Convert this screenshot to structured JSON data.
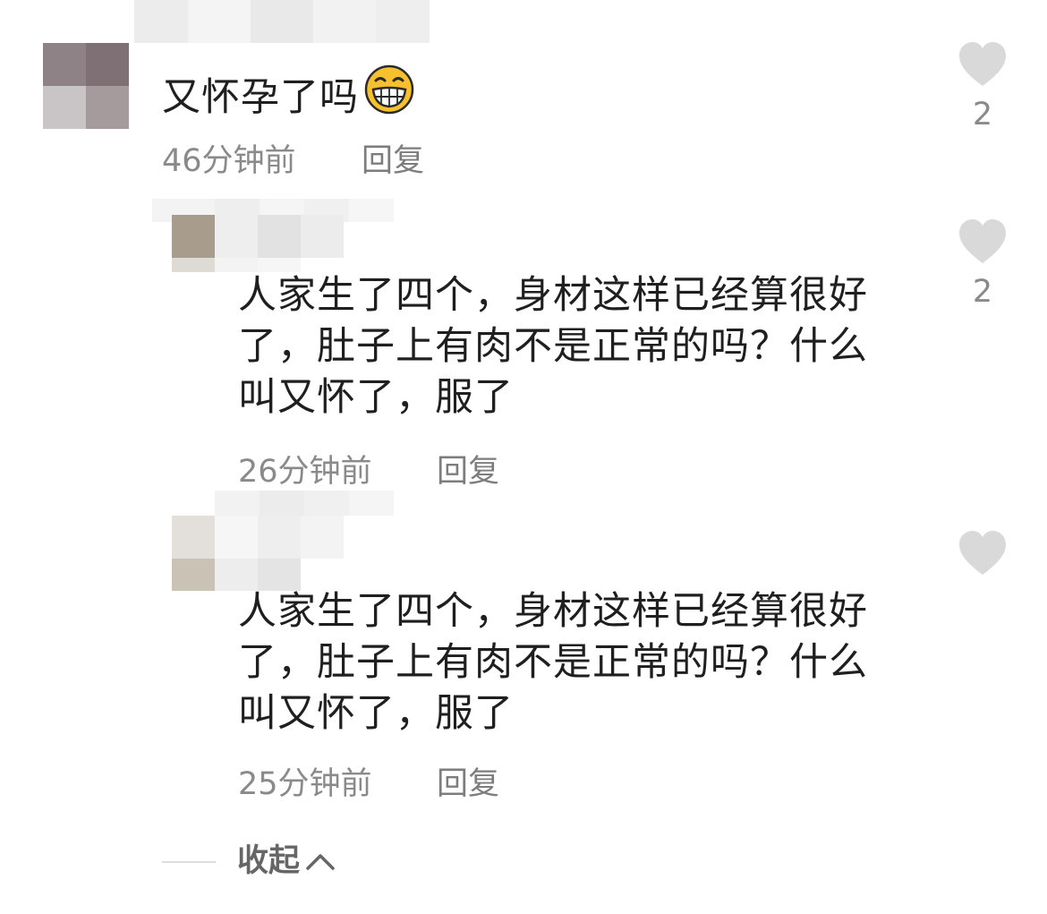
{
  "comments": [
    {
      "text": "又怀孕了吗",
      "emoji": "grinning-face-emoji",
      "time": "46分钟前",
      "reply_label": "回复",
      "likes": "2"
    }
  ],
  "replies": [
    {
      "text": [
        "人家生了四个，身材这样已经算很好",
        "了，肚子上有肉不是正常的吗？什么",
        "叫又怀了，服了"
      ],
      "time": "26分钟前",
      "reply_label": "回复",
      "likes": "2"
    },
    {
      "text": [
        "人家生了四个，身材这样已经算很好",
        "了，肚子上有肉不是正常的吗？什么",
        "叫又怀了，服了"
      ],
      "time": "25分钟前",
      "reply_label": "回复"
    }
  ],
  "collapse_label": "收起",
  "icons": {
    "like": "heart-icon",
    "collapse": "chevron-up-icon"
  },
  "colors": {
    "heart": "#d9d9d9",
    "meta_text": "#8a8a8a",
    "body_text": "#1f1f1f"
  }
}
